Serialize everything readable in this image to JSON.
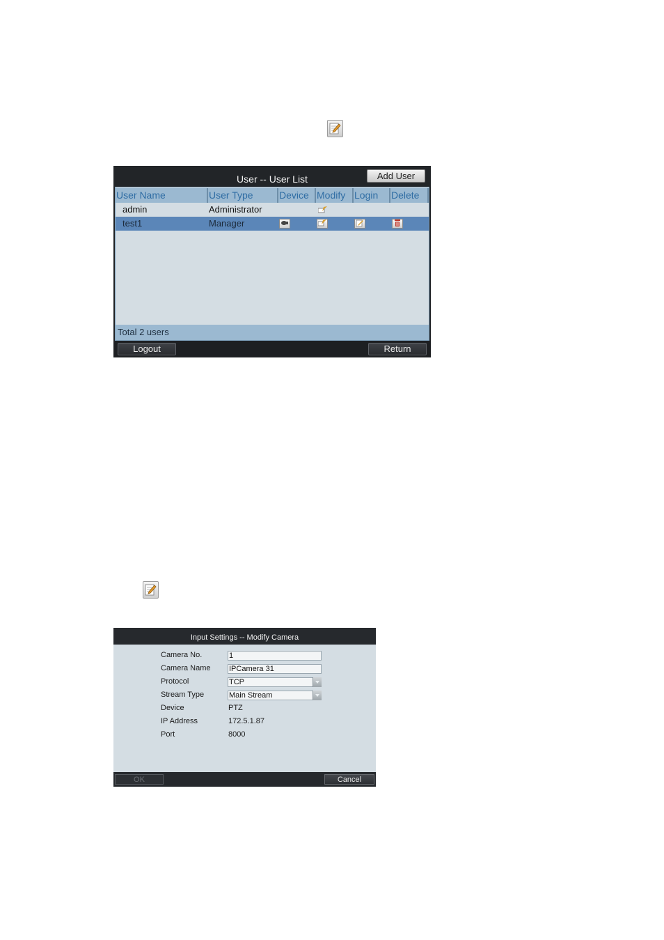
{
  "user_list": {
    "title": "User -- User List",
    "add_user_label": "Add User",
    "columns": [
      "User Name",
      "User Type",
      "Device",
      "Modify",
      "Login",
      "Delete"
    ],
    "rows": [
      {
        "name": "admin",
        "type": "Administrator",
        "selected": false
      },
      {
        "name": "test1",
        "type": "Manager",
        "selected": true
      }
    ],
    "total_text": "Total 2 users",
    "logout_label": "Logout",
    "return_label": "Return"
  },
  "modify_camera": {
    "title": "Input Settings -- Modify Camera",
    "fields": {
      "camera_no": {
        "label": "Camera No.",
        "value": "1"
      },
      "camera_name": {
        "label": "Camera Name",
        "value": "IPCamera 31"
      },
      "protocol": {
        "label": "Protocol",
        "value": "TCP"
      },
      "stream_type": {
        "label": "Stream Type",
        "value": "Main Stream"
      },
      "device": {
        "label": "Device",
        "value": "PTZ"
      },
      "ip_address": {
        "label": "IP Address",
        "value": "172.5.1.87"
      },
      "port": {
        "label": "Port",
        "value": "8000"
      }
    },
    "ok_label": "OK",
    "cancel_label": "Cancel"
  },
  "icons": {
    "edit": "edit-icon",
    "device": "camera-icon",
    "modify": "modify-icon",
    "login": "edit-icon",
    "delete": "trash-icon"
  },
  "colors": {
    "header_blue": "#9bb9d1",
    "selected_row": "#5b86b8",
    "panel_bg": "#d4dde3",
    "dark_bar": "#1d1f22",
    "delete_red": "#c0392b"
  }
}
